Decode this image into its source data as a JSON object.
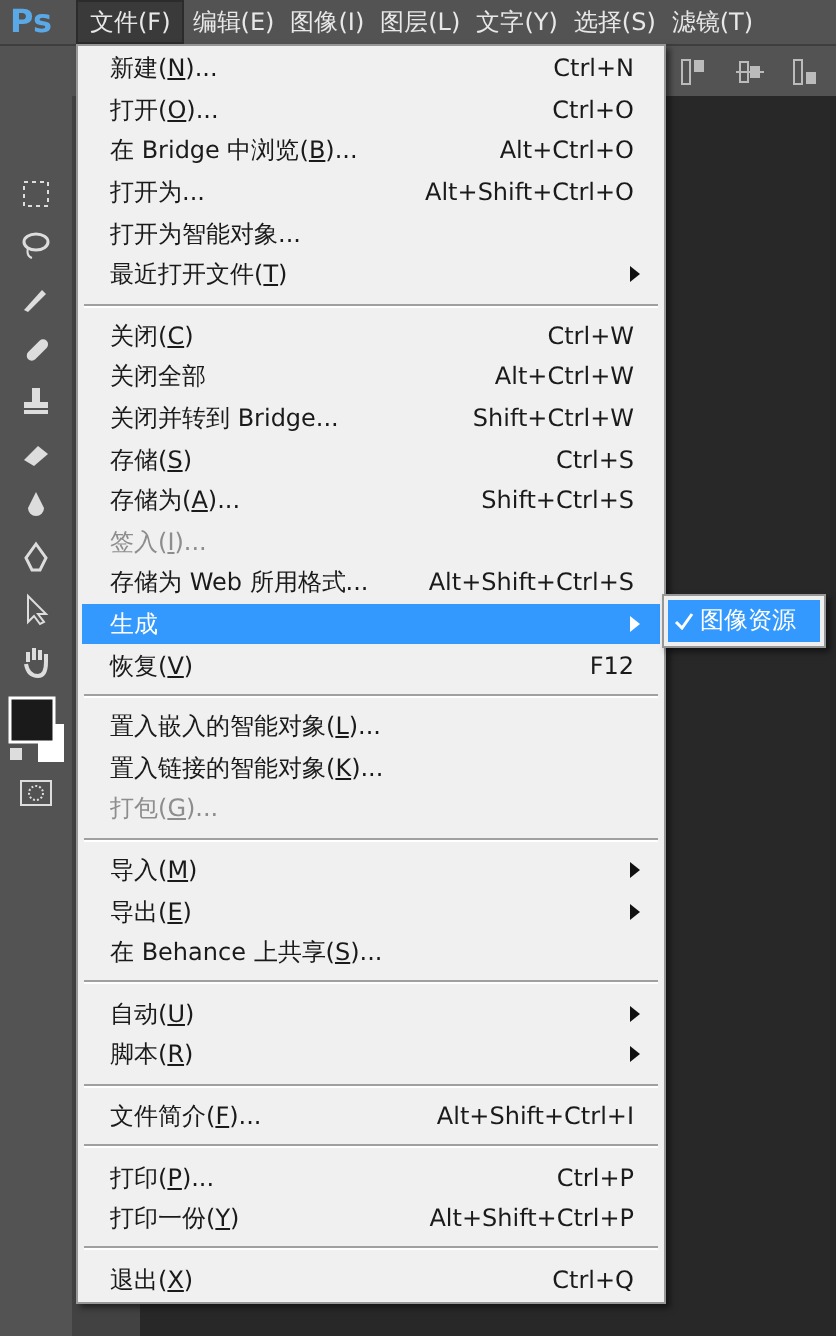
{
  "app_logo": "Ps",
  "menubar": [
    {
      "label": "文件(F)",
      "selected": true
    },
    {
      "label": "编辑(E)",
      "selected": false
    },
    {
      "label": "图像(I)",
      "selected": false
    },
    {
      "label": "图层(L)",
      "selected": false
    },
    {
      "label": "文字(Y)",
      "selected": false
    },
    {
      "label": "选择(S)",
      "selected": false
    },
    {
      "label": "滤镜(T)",
      "selected": false
    }
  ],
  "menu": {
    "groups": [
      [
        {
          "label": "新建(N)...",
          "shortcut": "Ctrl+N",
          "submenu": false,
          "disabled": false,
          "selected": false
        },
        {
          "label": "打开(O)...",
          "shortcut": "Ctrl+O",
          "submenu": false,
          "disabled": false,
          "selected": false
        },
        {
          "label": "在 Bridge 中浏览(B)...",
          "shortcut": "Alt+Ctrl+O",
          "submenu": false,
          "disabled": false,
          "selected": false
        },
        {
          "label": "打开为...",
          "shortcut": "Alt+Shift+Ctrl+O",
          "submenu": false,
          "disabled": false,
          "selected": false
        },
        {
          "label": "打开为智能对象...",
          "submenu": false,
          "disabled": false,
          "selected": false
        },
        {
          "label": "最近打开文件(T)",
          "submenu": true,
          "disabled": false,
          "selected": false
        }
      ],
      [
        {
          "label": "关闭(C)",
          "shortcut": "Ctrl+W",
          "submenu": false,
          "disabled": false,
          "selected": false
        },
        {
          "label": "关闭全部",
          "shortcut": "Alt+Ctrl+W",
          "submenu": false,
          "disabled": false,
          "selected": false
        },
        {
          "label": "关闭并转到 Bridge...",
          "shortcut": "Shift+Ctrl+W",
          "submenu": false,
          "disabled": false,
          "selected": false
        },
        {
          "label": "存储(S)",
          "shortcut": "Ctrl+S",
          "submenu": false,
          "disabled": false,
          "selected": false
        },
        {
          "label": "存储为(A)...",
          "shortcut": "Shift+Ctrl+S",
          "submenu": false,
          "disabled": false,
          "selected": false
        },
        {
          "label": "签入(I)...",
          "submenu": false,
          "disabled": true,
          "selected": false
        },
        {
          "label": "存储为 Web 所用格式...",
          "shortcut": "Alt+Shift+Ctrl+S",
          "submenu": false,
          "disabled": false,
          "selected": false
        },
        {
          "label": "生成",
          "submenu": true,
          "disabled": false,
          "selected": true,
          "children": [
            {
              "label": "图像资源",
              "checked": true
            }
          ]
        },
        {
          "label": "恢复(V)",
          "shortcut": "F12",
          "submenu": false,
          "disabled": false,
          "selected": false
        }
      ],
      [
        {
          "label": "置入嵌入的智能对象(L)...",
          "submenu": false,
          "disabled": false,
          "selected": false
        },
        {
          "label": "置入链接的智能对象(K)...",
          "submenu": false,
          "disabled": false,
          "selected": false
        },
        {
          "label": "打包(G)...",
          "submenu": false,
          "disabled": true,
          "selected": false
        }
      ],
      [
        {
          "label": "导入(M)",
          "submenu": true,
          "disabled": false,
          "selected": false
        },
        {
          "label": "导出(E)",
          "submenu": true,
          "disabled": false,
          "selected": false
        },
        {
          "label": "在 Behance 上共享(S)...",
          "submenu": false,
          "disabled": false,
          "selected": false
        }
      ],
      [
        {
          "label": "自动(U)",
          "submenu": true,
          "disabled": false,
          "selected": false
        },
        {
          "label": "脚本(R)",
          "submenu": true,
          "disabled": false,
          "selected": false
        }
      ],
      [
        {
          "label": "文件简介(F)...",
          "shortcut": "Alt+Shift+Ctrl+I",
          "submenu": false,
          "disabled": false,
          "selected": false
        }
      ],
      [
        {
          "label": "打印(P)...",
          "shortcut": "Ctrl+P",
          "submenu": false,
          "disabled": false,
          "selected": false
        },
        {
          "label": "打印一份(Y)",
          "shortcut": "Alt+Shift+Ctrl+P",
          "submenu": false,
          "disabled": false,
          "selected": false
        }
      ],
      [
        {
          "label": "退出(X)",
          "shortcut": "Ctrl+Q",
          "submenu": false,
          "disabled": false,
          "selected": false
        }
      ]
    ]
  }
}
